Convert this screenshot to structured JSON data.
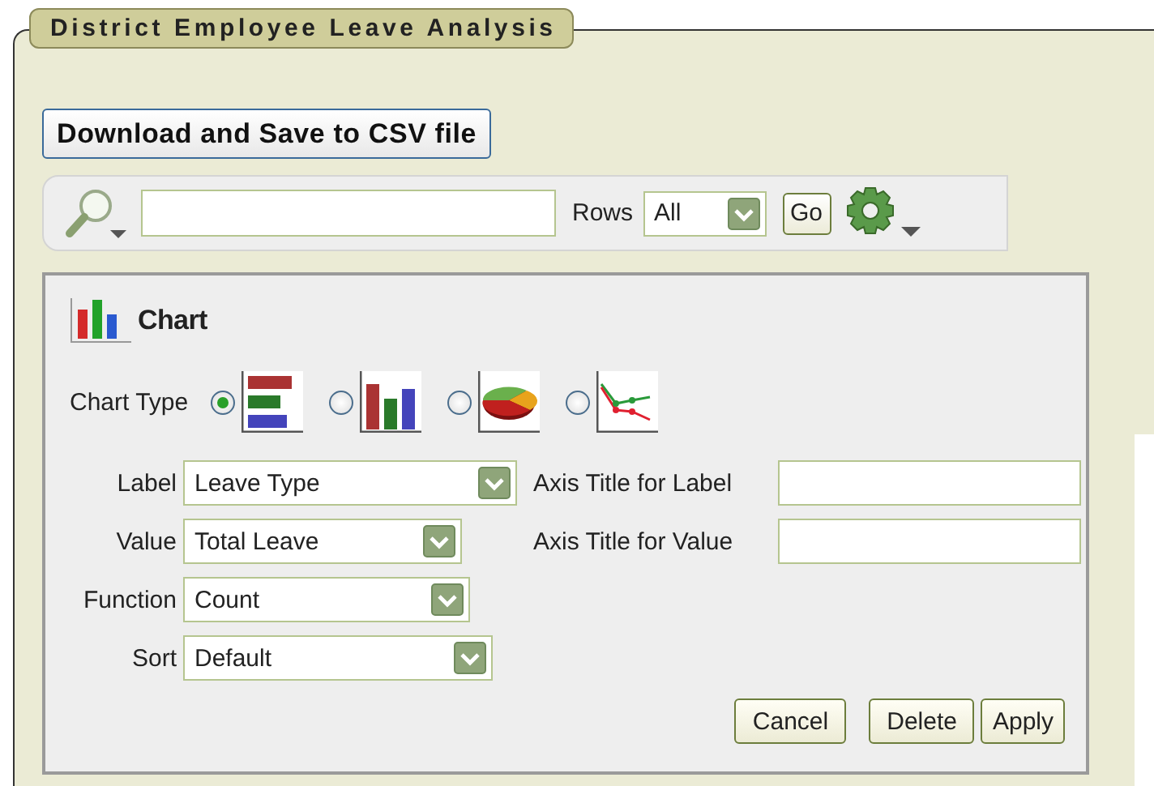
{
  "region": {
    "title": "District Employee Leave Analysis"
  },
  "download_button": "Download and Save to CSV file",
  "toolbar": {
    "rows_label": "Rows",
    "rows_select": "All",
    "go_button": "Go"
  },
  "chart_panel": {
    "title": "Chart",
    "chart_type_label": "Chart Type",
    "chart_types": [
      {
        "kind": "horizontal-bar",
        "selected": true
      },
      {
        "kind": "vertical-bar",
        "selected": false
      },
      {
        "kind": "pie",
        "selected": false
      },
      {
        "kind": "line",
        "selected": false
      }
    ],
    "fields": [
      {
        "label": "Label",
        "value": "Leave Type"
      },
      {
        "label": "Value",
        "value": "Total Leave"
      },
      {
        "label": "Function",
        "value": "Count"
      },
      {
        "label": "Sort",
        "value": "Default"
      }
    ],
    "axis_fields": [
      {
        "label": "Axis Title for Label"
      },
      {
        "label": "Axis Title for Value"
      }
    ],
    "buttons": [
      "Cancel",
      "Delete",
      "Apply"
    ]
  }
}
